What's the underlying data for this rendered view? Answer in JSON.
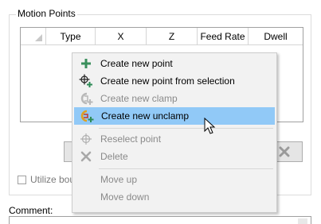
{
  "group": {
    "title": "Motion Points"
  },
  "grid": {
    "columns": [
      {
        "label": "Type",
        "width": 62
      },
      {
        "label": "X",
        "width": 64
      },
      {
        "label": "Z",
        "width": 64
      },
      {
        "label": "Feed Rate",
        "width": 64
      },
      {
        "label": "Dwell",
        "width": 68
      }
    ]
  },
  "options": {
    "utilize_label": "Utilize bour"
  },
  "comment": {
    "label": "Comment:"
  },
  "menu": {
    "items": [
      {
        "label": "Create new point",
        "icon": "plus-icon",
        "enabled": true
      },
      {
        "label": "Create new point from selection",
        "icon": "crosshair-plus-icon",
        "enabled": true
      },
      {
        "label": "Create new clamp",
        "icon": "clamp-add-icon",
        "enabled": false
      },
      {
        "label": "Create new unclamp",
        "icon": "unclamp-add-icon",
        "enabled": true,
        "highlighted": true
      },
      {
        "label": "Reselect point",
        "icon": "crosshair-icon",
        "enabled": false
      },
      {
        "label": "Delete",
        "icon": "delete-x-icon",
        "enabled": false
      },
      {
        "label": "Move up",
        "icon": "",
        "enabled": false
      },
      {
        "label": "Move down",
        "icon": "",
        "enabled": false
      }
    ]
  },
  "colors": {
    "highlight": "#91c9f7",
    "menu_bg": "#f2f2f2",
    "plus_green": "#2e8b57"
  }
}
